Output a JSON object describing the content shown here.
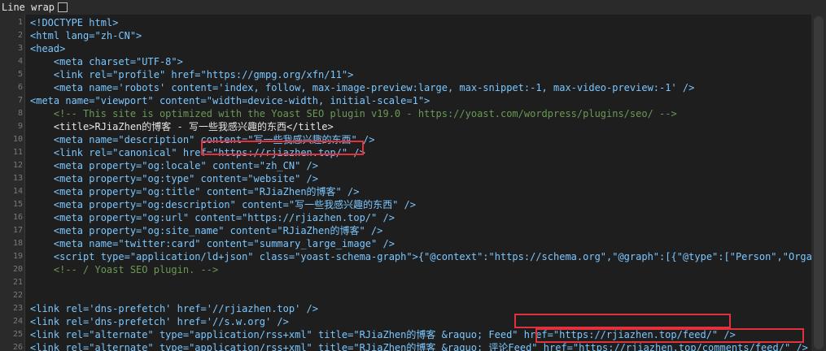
{
  "toolbar": {
    "line_wrap_label": "Line wrap"
  },
  "lines": [
    {
      "n": "1",
      "t": "<!DOCTYPE html>"
    },
    {
      "n": "2",
      "t": "<html lang=\"zh-CN\">"
    },
    {
      "n": "3",
      "t": "<head>"
    },
    {
      "n": "4",
      "t": "    <meta charset=\"UTF-8\">"
    },
    {
      "n": "5",
      "t": "    <link rel=\"profile\" href=\"https://gmpg.org/xfn/11\">"
    },
    {
      "n": "6",
      "t": "    <meta name='robots' content='index, follow, max-image-preview:large, max-snippet:-1, max-video-preview:-1' />"
    },
    {
      "n": "7",
      "t": "<meta name=\"viewport\" content=\"width=device-width, initial-scale=1\">"
    },
    {
      "n": "8",
      "t": "    <!-- This site is optimized with the Yoast SEO plugin v19.0 - https://yoast.com/wordpress/plugins/seo/ -->"
    },
    {
      "n": "9",
      "t": "    <title>RJiaZhen的博客 - 写一些我感兴趣的东西</title>"
    },
    {
      "n": "10",
      "t": "    <meta name=\"description\" content=\"写一些我感兴趣的东西\" />"
    },
    {
      "n": "11",
      "t": "    <link rel=\"canonical\" href=\"https://rjiazhen.top/\" />"
    },
    {
      "n": "12",
      "t": "    <meta property=\"og:locale\" content=\"zh_CN\" />"
    },
    {
      "n": "13",
      "t": "    <meta property=\"og:type\" content=\"website\" />"
    },
    {
      "n": "14",
      "t": "    <meta property=\"og:title\" content=\"RJiaZhen的博客\" />"
    },
    {
      "n": "15",
      "t": "    <meta property=\"og:description\" content=\"写一些我感兴趣的东西\" />"
    },
    {
      "n": "16",
      "t": "    <meta property=\"og:url\" content=\"https://rjiazhen.top/\" />"
    },
    {
      "n": "17",
      "t": "    <meta property=\"og:site_name\" content=\"RJiaZhen的博客\" />"
    },
    {
      "n": "18",
      "t": "    <meta name=\"twitter:card\" content=\"summary_large_image\" />"
    },
    {
      "n": "19",
      "t": "    <script type=\"application/ld+json\" class=\"yoast-schema-graph\">{\"@context\":\"https://schema.org\",\"@graph\":[{\"@type\":[\"Person\",\"Organi"
    },
    {
      "n": "20",
      "t": "    <!-- / Yoast SEO plugin. -->"
    },
    {
      "n": "21",
      "t": ""
    },
    {
      "n": "22",
      "t": ""
    },
    {
      "n": "23",
      "t": "<link rel='dns-prefetch' href='//rjiazhen.top' />"
    },
    {
      "n": "24",
      "t": "<link rel='dns-prefetch' href='//s.w.org' />"
    },
    {
      "n": "25",
      "t": "<link rel=\"alternate\" type=\"application/rss+xml\" title=\"RJiaZhen的博客 &raquo; Feed\" href=\"https://rjiazhen.top/feed/\" />"
    },
    {
      "n": "26",
      "t": "<link rel=\"alternate\" type=\"application/rss+xml\" title=\"RJiaZhen的博客 &raquo; 评论Feed\" href=\"https://rjiazhen.top/comments/feed/\" />"
    }
  ]
}
